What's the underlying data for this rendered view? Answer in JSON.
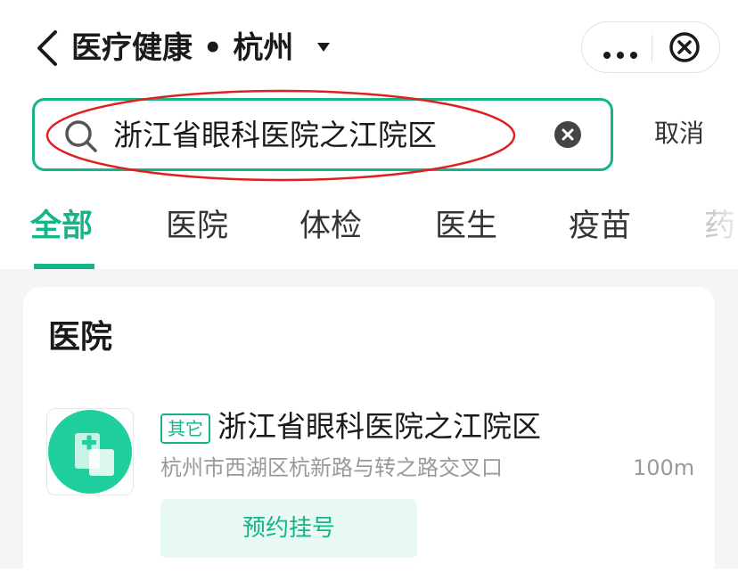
{
  "header": {
    "title": "医疗健康 • 杭州"
  },
  "search": {
    "value": "浙江省眼科医院之江院区",
    "cancel_label": "取消"
  },
  "tabs": [
    {
      "label": "全部",
      "active": true
    },
    {
      "label": "医院",
      "active": false
    },
    {
      "label": "体检",
      "active": false
    },
    {
      "label": "医生",
      "active": false
    },
    {
      "label": "疫苗",
      "active": false
    },
    {
      "label": "药",
      "active": false
    }
  ],
  "section": {
    "title": "医院"
  },
  "result": {
    "badge": "其它",
    "name": "浙江省眼科医院之江院区",
    "address": "杭州市西湖区杭新路与转之路交叉口",
    "distance": "100m",
    "action_label": "预约挂号"
  },
  "colors": {
    "accent": "#15b48a",
    "annotation": "#e02020"
  }
}
